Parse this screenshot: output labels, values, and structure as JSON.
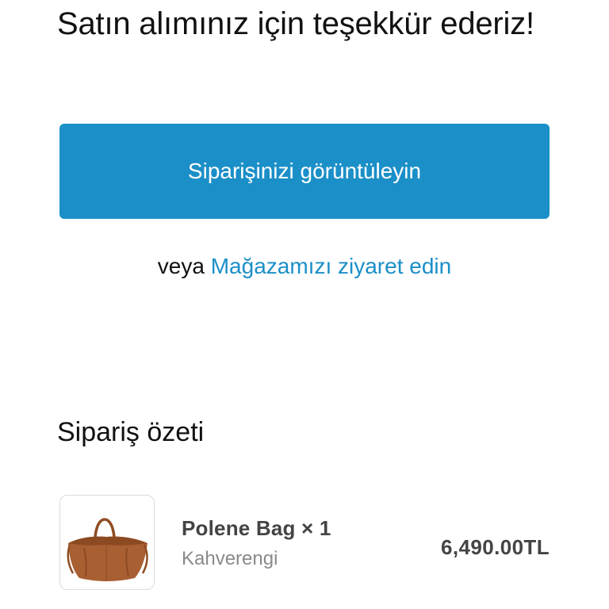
{
  "confirmation": {
    "heading": "Satın alımınız için teşekkür ederiz!",
    "view_order_label": "Siparişinizi görüntüleyin",
    "or_text": "veya",
    "visit_store_label": "Mağazamızı ziyaret edin"
  },
  "summary": {
    "title": "Sipariş özeti",
    "items": [
      {
        "name": "Polene Bag × 1",
        "variant": "Kahverengi",
        "price": "6,490.00TL",
        "image_icon": "brown-handbag-image"
      }
    ]
  },
  "colors": {
    "accent": "#1b8fc8",
    "text": "#111111",
    "muted": "#8a8a8a",
    "bag": "#a85f32"
  }
}
